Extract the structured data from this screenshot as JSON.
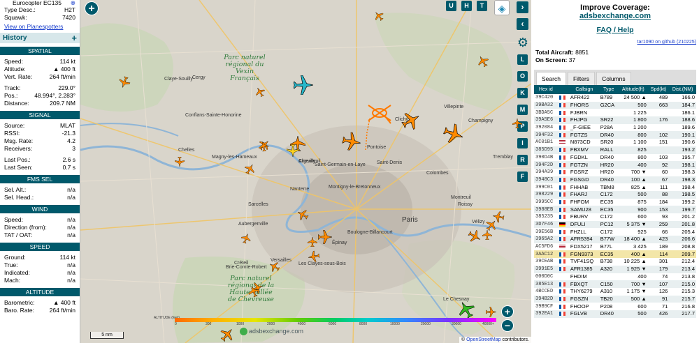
{
  "left_panel": {
    "top_title": "Eurocopter EC135",
    "top_rows": [
      {
        "label": "Type Desc.:",
        "value": "H2T"
      },
      {
        "label": "Squawk:",
        "value": "7420"
      }
    ],
    "planespotters_link": "View on Planespotters",
    "history_label": "History",
    "history_plus": "+",
    "sections": [
      {
        "title": "SPATIAL",
        "rows": [
          {
            "label": "Speed:",
            "value": "114 kt"
          },
          {
            "label": "Altitude:",
            "value": "▲ 400 ft"
          },
          {
            "label": "Vert. Rate:",
            "value": "264 ft/min"
          },
          {
            "label": "",
            "value": ""
          },
          {
            "label": "Track:",
            "value": "229.0°"
          },
          {
            "label": "Pos.:",
            "value": "48.994°, 2.283°"
          },
          {
            "label": "Distance:",
            "value": "209.7 NM"
          }
        ]
      },
      {
        "title": "SIGNAL",
        "rows": [
          {
            "label": "Source:",
            "value": "MLAT"
          },
          {
            "label": "RSSI:",
            "value": "-21.3"
          },
          {
            "label": "Msg. Rate:",
            "value": "4.2"
          },
          {
            "label": "Receivers:",
            "value": "3"
          },
          {
            "label": "",
            "value": ""
          },
          {
            "label": "Last Pos.:",
            "value": "2.6 s"
          },
          {
            "label": "Last Seen:",
            "value": "0.7 s"
          }
        ]
      },
      {
        "title": "FMS SEL",
        "rows": [
          {
            "label": "Sel. Alt.:",
            "value": "n/a"
          },
          {
            "label": "Sel. Head.:",
            "value": "n/a"
          }
        ]
      },
      {
        "title": "WIND",
        "rows": [
          {
            "label": "Speed:",
            "value": "n/a"
          },
          {
            "label": "Direction (from):",
            "value": "n/a"
          },
          {
            "label": "TAT / OAT:",
            "value": "n/a"
          }
        ]
      },
      {
        "title": "SPEED",
        "rows": [
          {
            "label": "Ground:",
            "value": "114 kt"
          },
          {
            "label": "True:",
            "value": "n/a"
          },
          {
            "label": "Indicated:",
            "value": "n/a"
          },
          {
            "label": "Mach:",
            "value": "n/a"
          }
        ]
      },
      {
        "title": "ALTITUDE",
        "rows": [
          {
            "label": "Barometric:",
            "value": "▲ 400 ft"
          },
          {
            "label": "Baro. Rate:",
            "value": "264 ft/min"
          }
        ]
      }
    ]
  },
  "map": {
    "layer_buttons": [
      "U",
      "H",
      "T"
    ],
    "side_buttons": [
      "L",
      "O",
      "K",
      "M",
      "P",
      "I",
      "R",
      "F"
    ],
    "zoom_in": "+",
    "zoom_out": "−",
    "park_labels": [
      "Parc naturel régional du Vexin Français",
      "Parc naturel régional de la Haute Vallée de Chevreuse"
    ],
    "city_label": "Paris",
    "places": [
      "Argenteuil",
      "Saint-Denis",
      "Boulogne-Billancourt",
      "Montreuil",
      "Nanterre",
      "Versailles",
      "Conflans-Sainte-Honorine",
      "Cergy",
      "Chelles",
      "Aubergenville",
      "Les Clayes-sous-Bois",
      "Vélizy",
      "Créteil",
      "Montigny-le-Bretonneux",
      "Clichy",
      "Sarcelles",
      "Le Chesnay",
      "Brie-Comte-Robert",
      "Magny-les-Hameaux",
      "Saint-Germain-en-Laye",
      "Colombes",
      "Villepinte",
      "Roissy",
      "Champigny",
      "Tremblay",
      "Claye-Souilly",
      "Pontoise",
      "Épinay",
      "Chevilly"
    ],
    "altitude_title": "ALTITUDE (feet)",
    "altitude_ticks": [
      "0",
      "300",
      "1000",
      "2000",
      "4000",
      "6000",
      "8000",
      "10000",
      "20000",
      "30000",
      "40000+"
    ],
    "watermark": "adsbexchange.com",
    "scale": "5 nm",
    "attribution_prefix": "© ",
    "attribution_link": "OpenStreetMap",
    "attribution_suffix": " contributors."
  },
  "right_panel": {
    "improve_line1": "Improve Coverage:",
    "improve_line2": "adsbexchange.com",
    "faq": "FAQ / Help",
    "credit": "tar1090 on github (210225)",
    "total_label": "Total Aircraft:",
    "total_value": "8851",
    "onscreen_label": "On Screen:",
    "onscreen_value": "37",
    "tabs": [
      "Search",
      "Filters",
      "Columns"
    ],
    "columns": [
      "Hex id",
      "",
      "Callsign",
      "Type",
      "Altitude(ft)",
      "Spd(kt)",
      "Dist.(NM)"
    ],
    "rows": [
      {
        "hex": "39C420",
        "flag": "fr",
        "cs": "AFR422",
        "type": "B789",
        "alt": "24 500 ▲",
        "spd": "489",
        "dist": "166.0"
      },
      {
        "hex": "39BA32",
        "flag": "fr",
        "cs": "FHORS",
        "type": "G2CA",
        "alt": "500",
        "spd": "663",
        "dist": "184.7"
      },
      {
        "hex": "3BDA5C",
        "flag": "fr",
        "cs": "FJBRN",
        "type": "",
        "alt": "1 225",
        "spd": "",
        "dist": "186.1"
      },
      {
        "hex": "39A5E6",
        "flag": "fr",
        "cs": "FHJPG",
        "type": "SR22",
        "alt": "1 800",
        "spd": "176",
        "dist": "188.6"
      },
      {
        "hex": "392084",
        "flag": "fr",
        "cs": "_F-GIEE",
        "type": "P28A",
        "alt": "1 200",
        "spd": "",
        "dist": "189.6"
      },
      {
        "hex": "394F32",
        "flag": "fr",
        "cs": "FGTZS",
        "type": "DR40",
        "alt": "800",
        "spd": "102",
        "dist": "190.1"
      },
      {
        "hex": "AC01B1",
        "flag": "us",
        "cs": "N873CD",
        "type": "SR20",
        "alt": "1 100",
        "spd": "151",
        "dist": "190.6"
      },
      {
        "hex": "385D95",
        "flag": "fr",
        "cs": "FBXMV",
        "type": "RALL",
        "alt": "825",
        "spd": "",
        "dist": "193.2"
      },
      {
        "hex": "390D4B",
        "flag": "fr",
        "cs": "FGDKL",
        "type": "DR40",
        "alt": "800",
        "spd": "103",
        "dist": "195.7"
      },
      {
        "hex": "394F2D",
        "flag": "fr",
        "cs": "FGTZN",
        "type": "HR20",
        "alt": "400",
        "spd": "92",
        "dist": "198.1"
      },
      {
        "hex": "394A39",
        "flag": "fr",
        "cs": "FGSRZ",
        "type": "HR20",
        "alt": "700 ▼",
        "spd": "60",
        "dist": "198.3"
      },
      {
        "hex": "3948C3",
        "flag": "fr",
        "cs": "FGSGD",
        "type": "DR40",
        "alt": "100 ▲",
        "spd": "67",
        "dist": "198.3"
      },
      {
        "hex": "399C01",
        "flag": "fr",
        "cs": "FHHAB",
        "type": "TBM8",
        "alt": "825 ▲",
        "spd": "111",
        "dist": "198.4"
      },
      {
        "hex": "398229",
        "flag": "fr",
        "cs": "FHARJ",
        "type": "C172",
        "alt": "500",
        "spd": "88",
        "dist": "198.5"
      },
      {
        "hex": "3995CC",
        "flag": "fr",
        "cs": "FHFOM",
        "type": "EC35",
        "alt": "875",
        "spd": "184",
        "dist": "199.2"
      },
      {
        "hex": "3988EB",
        "flag": "fr",
        "cs": "SAMU28",
        "type": "EC35",
        "alt": "900",
        "spd": "153",
        "dist": "199.7"
      },
      {
        "hex": "385235",
        "flag": "fr",
        "cs": "FBURV",
        "type": "C172",
        "alt": "600",
        "spd": "93",
        "dist": "201.2"
      },
      {
        "hex": "3D7F46",
        "flag": "de",
        "cs": "DFULI",
        "type": "PC12",
        "alt": "5 375 ▼",
        "spd": "259",
        "dist": "201.8"
      },
      {
        "hex": "39E56B",
        "flag": "fr",
        "cs": "FHZLL",
        "type": "C172",
        "alt": "925",
        "spd": "66",
        "dist": "205.4"
      },
      {
        "hex": "3965A2",
        "flag": "fr",
        "cs": "AFR5394",
        "type": "B77W",
        "alt": "18 400 ▲",
        "spd": "423",
        "dist": "206.6"
      },
      {
        "hex": "AC5FD6",
        "flag": "us",
        "cs": "FDX5217",
        "type": "B77L",
        "alt": "3 425",
        "spd": "189",
        "dist": "208.8"
      },
      {
        "hex": "3AAC12",
        "flag": "fr",
        "cs": "FGN9373",
        "type": "EC35",
        "alt": "400 ▲",
        "spd": "114",
        "dist": "209.7",
        "selected": true
      },
      {
        "hex": "39CEAB",
        "flag": "fr",
        "cs": "TVF41SQ",
        "type": "B738",
        "alt": "10 225 ▲",
        "spd": "301",
        "dist": "212.4"
      },
      {
        "hex": "3991E5",
        "flag": "fr",
        "cs": "AFR1385",
        "type": "A320",
        "alt": "1 925 ▼",
        "spd": "179",
        "dist": "213.4"
      },
      {
        "hex": "000D0C",
        "flag": "none",
        "cs": "FHDIM",
        "type": "",
        "alt": "400",
        "spd": "74",
        "dist": "213.8"
      },
      {
        "hex": "385E13",
        "flag": "fr",
        "cs": "FBXQT",
        "type": "C150",
        "alt": "700 ▼",
        "spd": "107",
        "dist": "215.0"
      },
      {
        "hex": "4BCCED",
        "flag": "fr",
        "cs": "THY6279",
        "type": "A310",
        "alt": "1 175 ▼",
        "spd": "126",
        "dist": "215.3"
      },
      {
        "hex": "394B2D",
        "flag": "fr",
        "cs": "FGSZN",
        "type": "TB20",
        "alt": "500 ▲",
        "spd": "91",
        "dist": "215.7"
      },
      {
        "hex": "39B9CF",
        "flag": "fr",
        "cs": "FHOOP",
        "type": "P208",
        "alt": "600",
        "spd": "71",
        "dist": "216.8"
      },
      {
        "hex": "392EA1",
        "flag": "fr",
        "cs": "FGLVB",
        "type": "DR40",
        "alt": "500",
        "spd": "426",
        "dist": "217.7"
      }
    ]
  },
  "colors": {
    "accent": "#00596b",
    "plane_default": "#ff8a00",
    "plane_yellow": "#ffd21e",
    "plane_cyan": "#27b7c9",
    "plane_green": "#33bb22",
    "selected_row": "#f3e6a8"
  }
}
